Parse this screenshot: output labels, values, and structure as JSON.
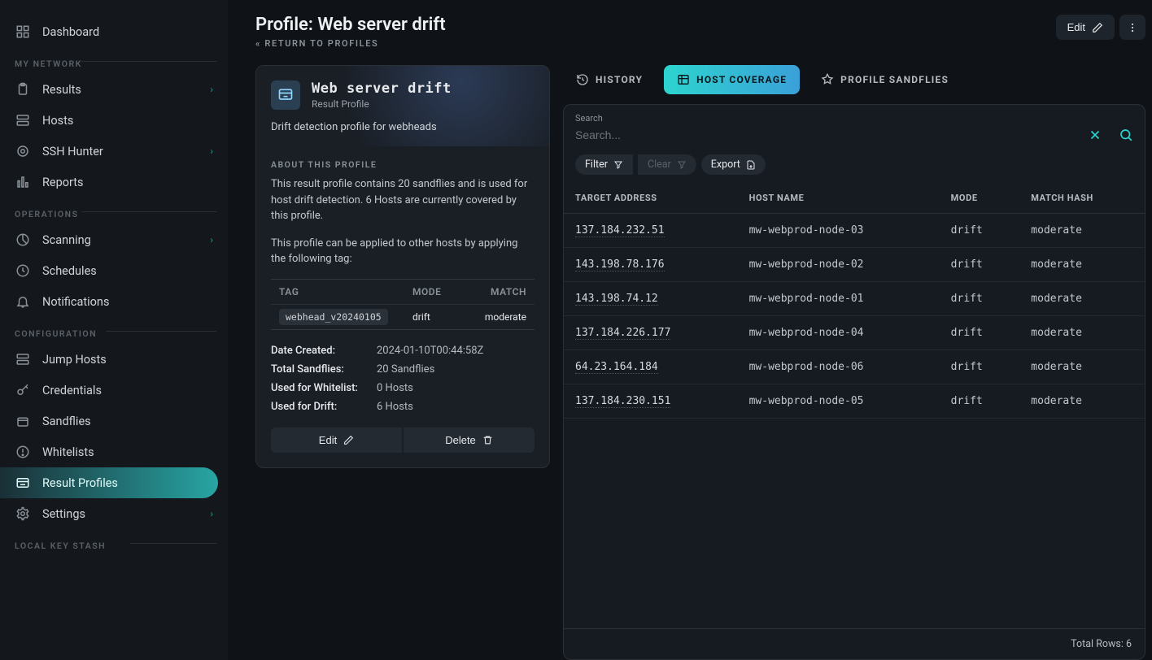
{
  "sidebar": {
    "sections": [
      {
        "label": null,
        "items": [
          {
            "id": "dashboard",
            "label": "Dashboard",
            "icon": "grid-icon",
            "chevron": false,
            "active": false
          }
        ]
      },
      {
        "label": "MY NETWORK",
        "items": [
          {
            "id": "results",
            "label": "Results",
            "icon": "clipboard-icon",
            "chevron": true,
            "active": false
          },
          {
            "id": "hosts",
            "label": "Hosts",
            "icon": "server-icon",
            "chevron": false,
            "active": false
          },
          {
            "id": "ssh-hunter",
            "label": "SSH Hunter",
            "icon": "target-icon",
            "chevron": true,
            "active": false
          },
          {
            "id": "reports",
            "label": "Reports",
            "icon": "barchart-icon",
            "chevron": false,
            "active": false
          }
        ]
      },
      {
        "label": "OPERATIONS",
        "items": [
          {
            "id": "scanning",
            "label": "Scanning",
            "icon": "radar-icon",
            "chevron": true,
            "active": false
          },
          {
            "id": "schedules",
            "label": "Schedules",
            "icon": "clock-icon",
            "chevron": false,
            "active": false
          },
          {
            "id": "notifications",
            "label": "Notifications",
            "icon": "bell-icon",
            "chevron": false,
            "active": false
          }
        ]
      },
      {
        "label": "CONFIGURATION",
        "items": [
          {
            "id": "jump-hosts",
            "label": "Jump Hosts",
            "icon": "server-icon",
            "chevron": false,
            "active": false
          },
          {
            "id": "credentials",
            "label": "Credentials",
            "icon": "key-icon",
            "chevron": false,
            "active": false
          },
          {
            "id": "sandflies",
            "label": "Sandflies",
            "icon": "package-icon",
            "chevron": false,
            "active": false
          },
          {
            "id": "whitelists",
            "label": "Whitelists",
            "icon": "alert-icon",
            "chevron": false,
            "active": false
          },
          {
            "id": "result-profiles",
            "label": "Result Profiles",
            "icon": "profile-icon",
            "chevron": false,
            "active": true
          },
          {
            "id": "settings",
            "label": "Settings",
            "icon": "gear-icon",
            "chevron": true,
            "active": false
          }
        ]
      },
      {
        "label": "LOCAL KEY STASH",
        "items": []
      }
    ]
  },
  "header": {
    "title": "Profile: Web server drift",
    "backlink": "RETURN TO PROFILES",
    "edit_label": "Edit"
  },
  "profile": {
    "name": "Web server drift",
    "subtitle": "Result Profile",
    "description": "Drift detection profile for webheads",
    "about_heading": "ABOUT THIS PROFILE",
    "about_p1": "This result profile contains 20 sandflies and is used for host drift detection. 6 Hosts are currently covered by this profile.",
    "about_p2": "This profile can be applied to other hosts by applying the following tag:",
    "mini_head": {
      "c1": "TAG",
      "c2": "MODE",
      "c3": "MATCH"
    },
    "mini_row": {
      "tag": "webhead_v20240105",
      "mode": "drift",
      "match": "moderate"
    },
    "meta": [
      {
        "k": "Date Created:",
        "v": "2024-01-10T00:44:58Z"
      },
      {
        "k": "Total Sandflies:",
        "v": "20 Sandflies"
      },
      {
        "k": "Used for Whitelist:",
        "v": "0 Hosts"
      },
      {
        "k": "Used for Drift:",
        "v": "6 Hosts"
      }
    ],
    "actions": {
      "edit": "Edit",
      "delete": "Delete"
    }
  },
  "tabs": [
    {
      "id": "history",
      "label": "HISTORY",
      "icon": "history-icon",
      "active": false
    },
    {
      "id": "host-coverage",
      "label": "HOST COVERAGE",
      "icon": "coverage-icon",
      "active": true
    },
    {
      "id": "profile-sandflies",
      "label": "PROFILE SANDFLIES",
      "icon": "sandfly-icon",
      "active": false
    }
  ],
  "search": {
    "label": "Search",
    "placeholder": "Search..."
  },
  "toolbar": {
    "filter": "Filter",
    "clear": "Clear",
    "export": "Export"
  },
  "table": {
    "columns": [
      "TARGET ADDRESS",
      "HOST NAME",
      "MODE",
      "MATCH HASH"
    ],
    "rows": [
      {
        "addr": "137.184.232.51",
        "host": "mw-webprod-node-03",
        "mode": "drift",
        "match": "moderate"
      },
      {
        "addr": "143.198.78.176",
        "host": "mw-webprod-node-02",
        "mode": "drift",
        "match": "moderate"
      },
      {
        "addr": "143.198.74.12",
        "host": "mw-webprod-node-01",
        "mode": "drift",
        "match": "moderate"
      },
      {
        "addr": "137.184.226.177",
        "host": "mw-webprod-node-04",
        "mode": "drift",
        "match": "moderate"
      },
      {
        "addr": "64.23.164.184",
        "host": "mw-webprod-node-06",
        "mode": "drift",
        "match": "moderate"
      },
      {
        "addr": "137.184.230.151",
        "host": "mw-webprod-node-05",
        "mode": "drift",
        "match": "moderate"
      }
    ],
    "footer": "Total Rows: 6"
  }
}
